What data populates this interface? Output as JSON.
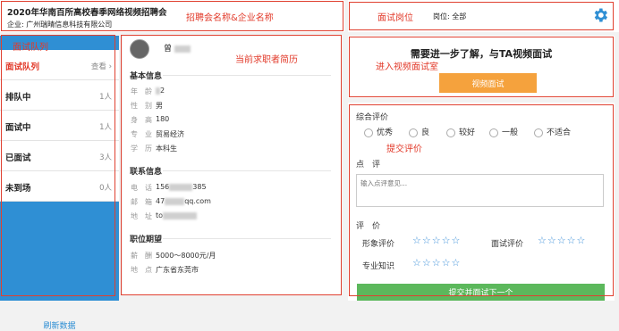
{
  "header": {
    "title": "2020年华南百所高校春季网络视频招聘会",
    "company_prefix": "企业:",
    "company": "广州瑞晴信息科技有限公司"
  },
  "position_bar": {
    "label": "岗位:",
    "value": "全部"
  },
  "annotations": {
    "fair_company": "招聘会名称&企业名称",
    "position": "面试岗位",
    "queue": "面试队列",
    "resume": "当前求职者简历",
    "video_room": "进入视频面试室",
    "submit_eval": "提交评价"
  },
  "sidebar": {
    "items": [
      {
        "label": "面试队列",
        "count": "查看 ›"
      },
      {
        "label": "排队中",
        "count": "1人"
      },
      {
        "label": "面试中",
        "count": "1人"
      },
      {
        "label": "已面试",
        "count": "3人"
      },
      {
        "label": "未到场",
        "count": "0人"
      }
    ],
    "refresh": "刷新数据"
  },
  "resume": {
    "name": "曾",
    "basic_title": "基本信息",
    "basic": [
      {
        "k": "年　龄",
        "v": "2"
      },
      {
        "k": "性　别",
        "v": "男"
      },
      {
        "k": "身　高",
        "v": "180"
      },
      {
        "k": "专　业",
        "v": "贸易经济"
      },
      {
        "k": "学　历",
        "v": "本科生"
      }
    ],
    "contact_title": "联系信息",
    "contact": [
      {
        "k": "电　话",
        "v1": "156",
        "v2": "385"
      },
      {
        "k": "邮　箱",
        "v1": "47",
        "v2": "qq.com"
      },
      {
        "k": "地　址",
        "v1": "to",
        "v2": ""
      }
    ],
    "job_title": "职位期望",
    "job": [
      {
        "k": "薪　酬",
        "v": "5000～8000元/月"
      },
      {
        "k": "地　点",
        "v": "广东省东莞市"
      }
    ]
  },
  "video": {
    "headline": "需要进一步了解，与TA视频面试",
    "button": "视频面试"
  },
  "evaluation": {
    "overall_title": "综合评价",
    "options": [
      "优秀",
      "良",
      "较好",
      "一般",
      "不适合"
    ],
    "comment_title": "点　评",
    "comment_placeholder": "输入点评意见...",
    "rating_title": "评　价",
    "ratings": [
      "形象评价",
      "面试评价",
      "专业知识"
    ],
    "stars": "☆☆☆☆☆",
    "submit": "提交并面试下一个"
  },
  "colors": {
    "accent_blue": "#2f8fd4",
    "orange": "#f5a23d",
    "green": "#5cb85c",
    "annotation_red": "#e23a2a"
  }
}
